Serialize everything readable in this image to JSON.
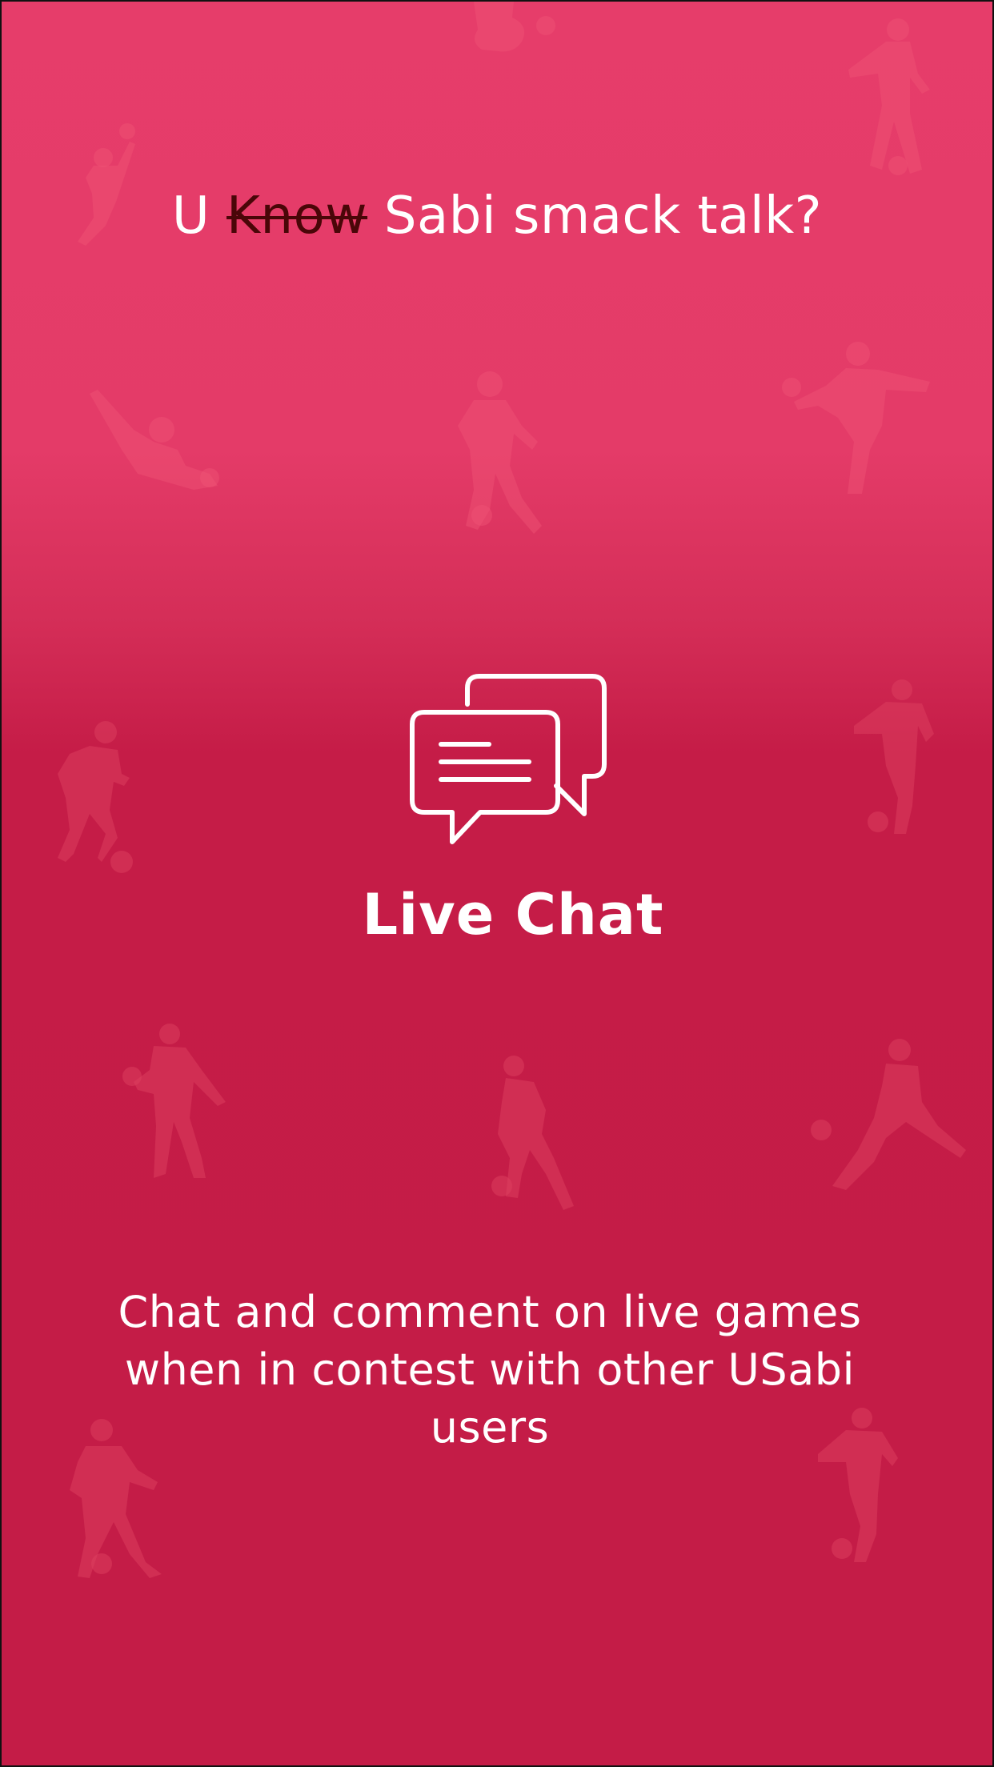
{
  "onboarding": {
    "headline_prefix": "U ",
    "headline_strike": "Know",
    "headline_suffix": " Sabi smack talk?",
    "feature_icon": "chat-bubbles-icon",
    "feature_title": "Live Chat",
    "description": "Chat and comment on live games when in contest with other USabi users"
  },
  "colors": {
    "background_top": "#e63d6a",
    "background_bottom": "#c41c47",
    "text": "#ffffff",
    "strike_text": "#4a0608"
  }
}
